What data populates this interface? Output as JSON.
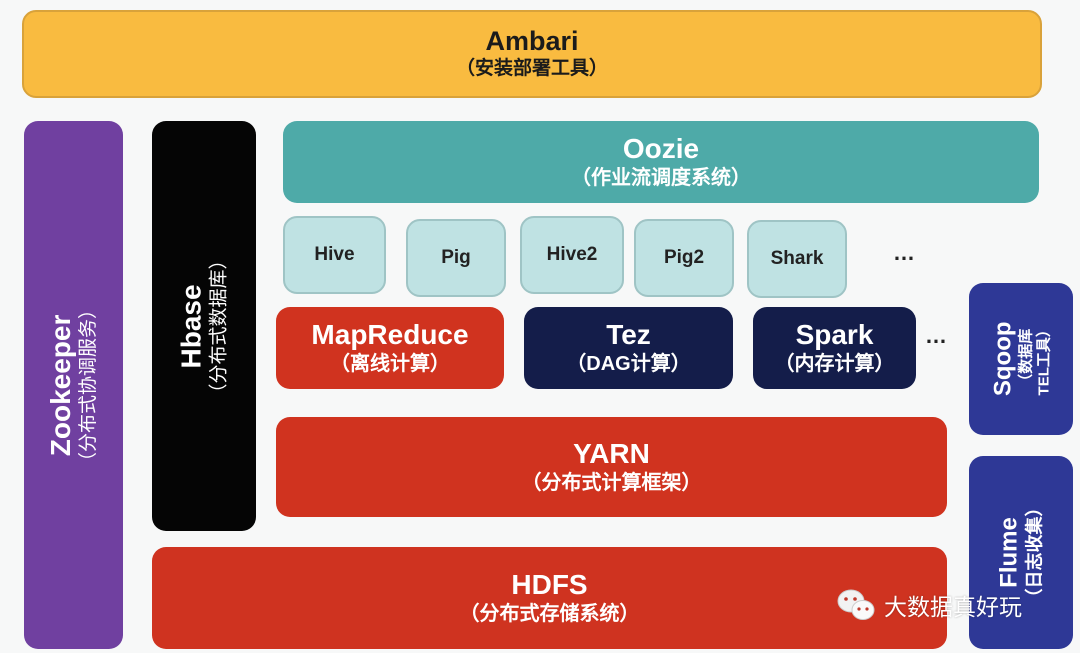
{
  "ambari": {
    "title": "Ambari",
    "subtitle": "（安装部署工具）"
  },
  "zookeeper": {
    "title": "Zookeeper",
    "subtitle": "（分布式协调服务）"
  },
  "hbase": {
    "title": "Hbase",
    "subtitle": "（分布式数据库）"
  },
  "oozie": {
    "title": "Oozie",
    "subtitle": "（作业流调度系统）"
  },
  "tools": [
    "Hive",
    "Pig",
    "Hive2",
    "Pig2",
    "Shark"
  ],
  "tools_more": "…",
  "engines": {
    "mapreduce": {
      "title": "MapReduce",
      "subtitle": "（离线计算）"
    },
    "tez": {
      "title": "Tez",
      "subtitle": "（DAG计算）"
    },
    "spark": {
      "title": "Spark",
      "subtitle": "（内存计算）"
    },
    "more": "…"
  },
  "yarn": {
    "title": "YARN",
    "subtitle": "（分布式计算框架）"
  },
  "hdfs": {
    "title": "HDFS",
    "subtitle": "（分布式存储系统）"
  },
  "sqoop": {
    "title": "Sqoop",
    "subtitle_line1": "（数据库",
    "subtitle_line2": "TEL工具）"
  },
  "flume": {
    "title": "Flume",
    "subtitle": "（日志收集）"
  },
  "watermark": {
    "text": "大数据真好玩",
    "icon": "wechat-icon"
  },
  "colors": {
    "ambari": "#f9bb40",
    "zookeeper": "#7040a0",
    "hbase": "#050505",
    "oozie": "#4eaaa8",
    "tools": "#bfe2e3",
    "mapreduce": "#d0331f",
    "tez_spark": "#141d4a",
    "yarn_hdfs": "#d0331f",
    "sqoop_flume": "#2e3896"
  }
}
